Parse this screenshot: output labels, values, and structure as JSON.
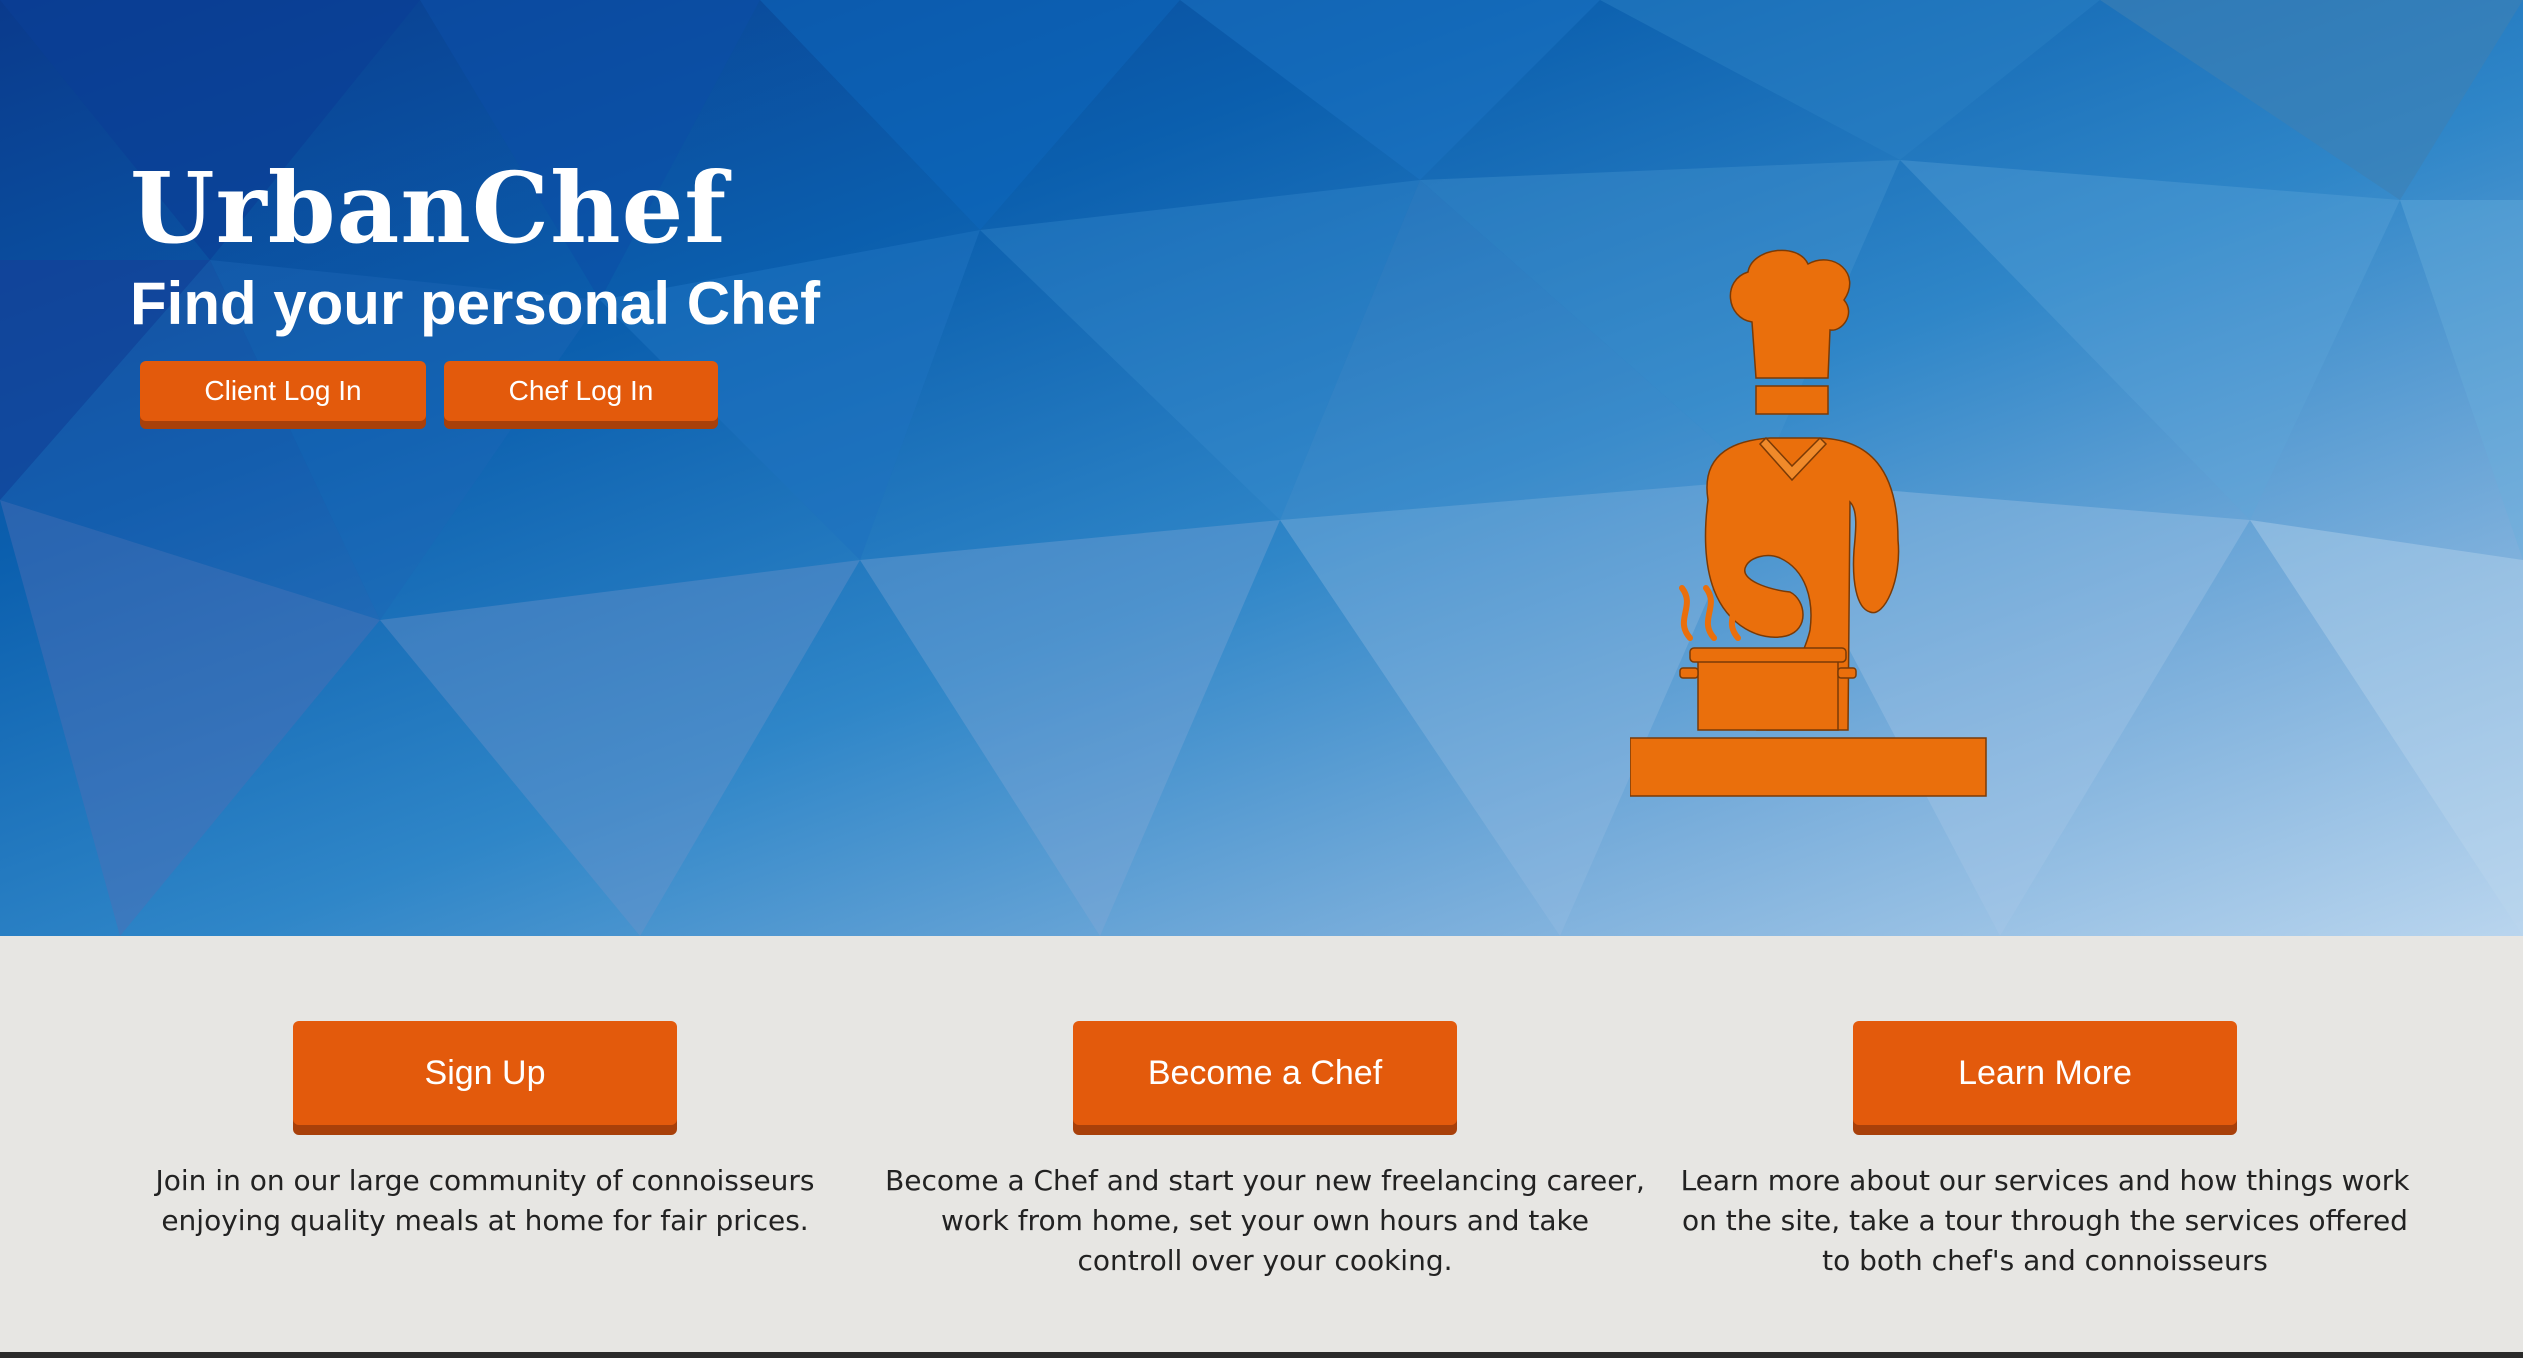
{
  "hero": {
    "brand": "UrbanChef",
    "tagline": "Find your personal Chef",
    "client_login_label": "Client Log In",
    "chef_login_label": "Chef Log In",
    "illustration_icon": "chef-cooking-icon"
  },
  "features": [
    {
      "button_label": "Sign Up",
      "description": "Join in on our large community of connoisseurs enjoying quality meals at home for fair prices."
    },
    {
      "button_label": "Become a Chef",
      "description": "Become a Chef and start your new freelancing career, work from home, set your own hours and take controll over your cooking."
    },
    {
      "button_label": "Learn More",
      "description": "Learn more about our services and how things work on the site, take a tour through the services offered to both chef's and connoisseurs"
    }
  ],
  "colors": {
    "accent": "#e35a0c",
    "accent_shadow": "#a8400a",
    "hero_dark": "#0a3a8c",
    "hero_light": "#b9d5ee",
    "illustration": "#ea6f0c",
    "section_bg": "#e7e6e3"
  }
}
